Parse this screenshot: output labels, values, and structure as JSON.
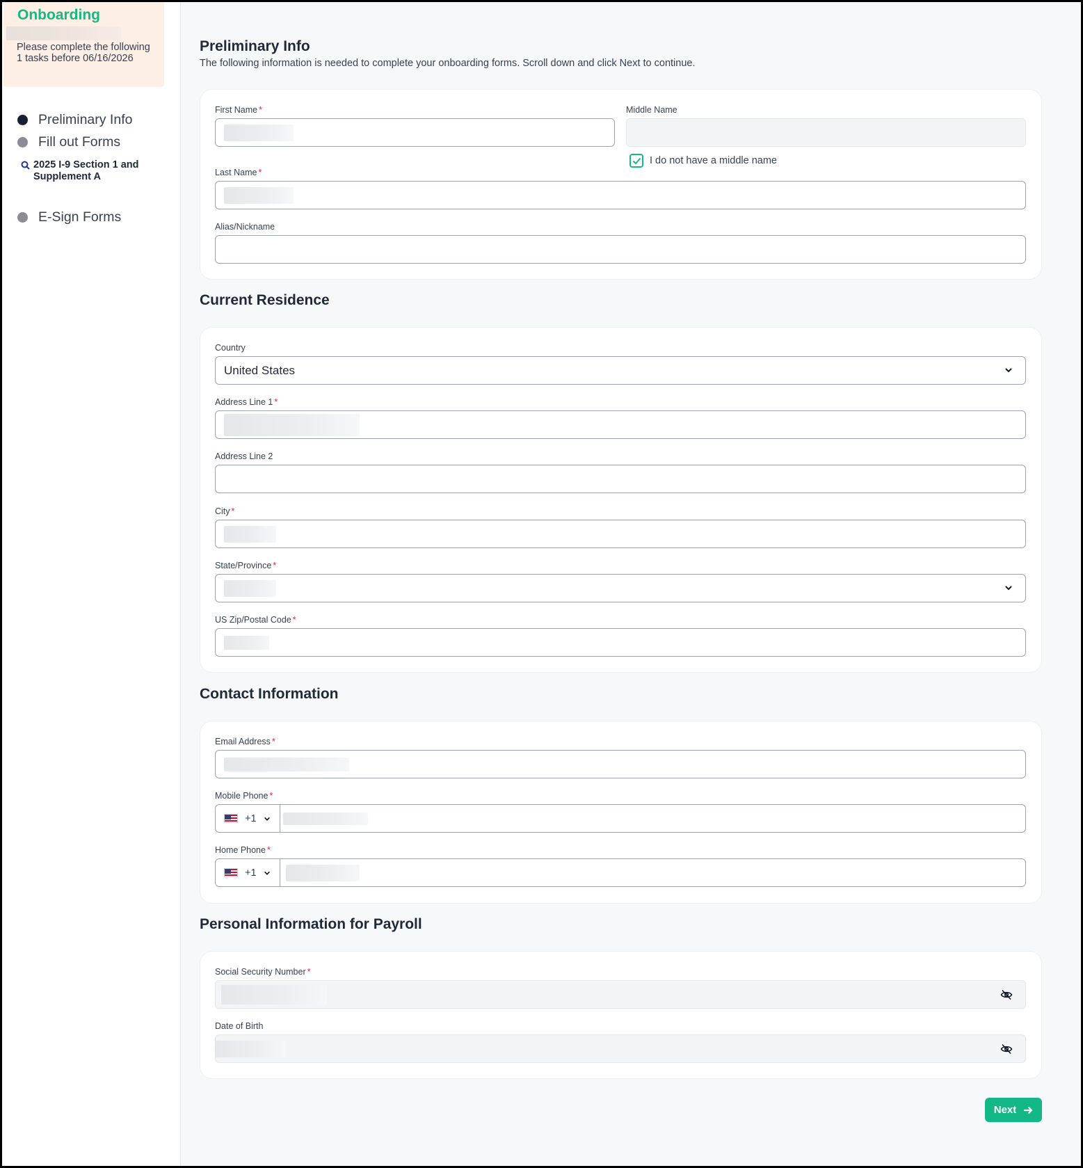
{
  "sidebar": {
    "title": "Onboarding",
    "description": "Please complete the following 1 tasks before 06/16/2026",
    "steps": [
      {
        "label": "Preliminary Info",
        "active": true
      },
      {
        "label": "Fill out Forms",
        "active": false
      },
      {
        "label": "E-Sign Forms",
        "active": false
      }
    ],
    "substep": "2025 I-9 Section 1 and Supplement A"
  },
  "preliminary": {
    "title": "Preliminary Info",
    "subtitle": "The following information is needed to complete your onboarding forms. Scroll down and click Next to continue.",
    "first_name_label": "First Name",
    "middle_name_label": "Middle Name",
    "no_middle_label": "I do not have a middle name",
    "last_name_label": "Last Name",
    "alias_label": "Alias/Nickname"
  },
  "residence": {
    "title": "Current Residence",
    "country_label": "Country",
    "country_value": "United States",
    "address1_label": "Address Line 1",
    "address2_label": "Address Line 2",
    "city_label": "City",
    "state_label": "State/Province",
    "zip_label": "US Zip/Postal Code"
  },
  "contact": {
    "title": "Contact Information",
    "email_label": "Email Address",
    "mobile_label": "Mobile Phone",
    "home_label": "Home Phone",
    "country_code": "+1"
  },
  "payroll": {
    "title": "Personal Information for Payroll",
    "ssn_label": "Social Security Number",
    "dob_label": "Date of Birth"
  },
  "actions": {
    "next_label": "Next"
  },
  "colors": {
    "accent": "#12b886",
    "required": "#e11d48",
    "active_dot": "#1c1e36",
    "inactive_dot": "#8b8d94"
  }
}
